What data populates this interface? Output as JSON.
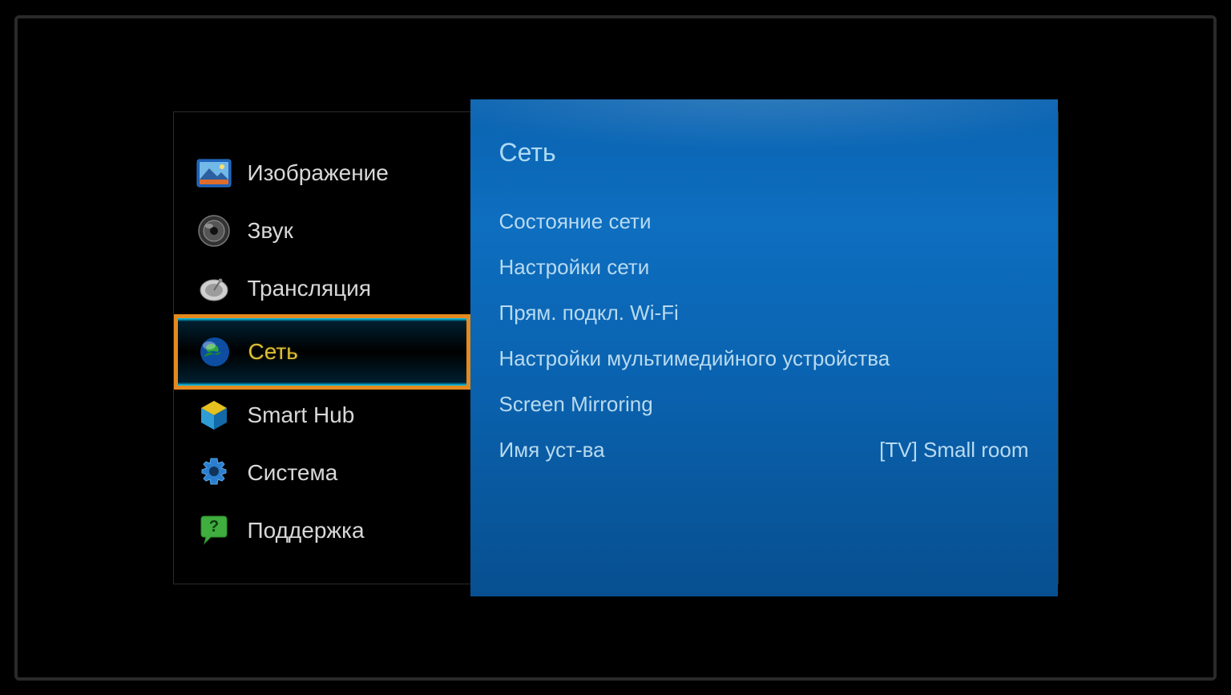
{
  "sidebar": {
    "items": [
      {
        "label": "Изображение",
        "icon": "picture-icon"
      },
      {
        "label": "Звук",
        "icon": "speaker-icon"
      },
      {
        "label": "Трансляция",
        "icon": "dish-icon"
      },
      {
        "label": "Сеть",
        "icon": "globe-icon",
        "selected": true
      },
      {
        "label": "Smart Hub",
        "icon": "cube-icon"
      },
      {
        "label": "Система",
        "icon": "gear-icon"
      },
      {
        "label": "Поддержка",
        "icon": "support-icon"
      }
    ]
  },
  "panel": {
    "title": "Сеть",
    "options": [
      {
        "label": "Состояние сети"
      },
      {
        "label": "Настройки сети"
      },
      {
        "label": "Прям. подкл. Wi-Fi"
      },
      {
        "label": "Настройки мультимедийного устройства"
      },
      {
        "label": "Screen Mirroring"
      },
      {
        "label": "Имя уст-ва",
        "value": "[TV] Small room"
      }
    ]
  }
}
